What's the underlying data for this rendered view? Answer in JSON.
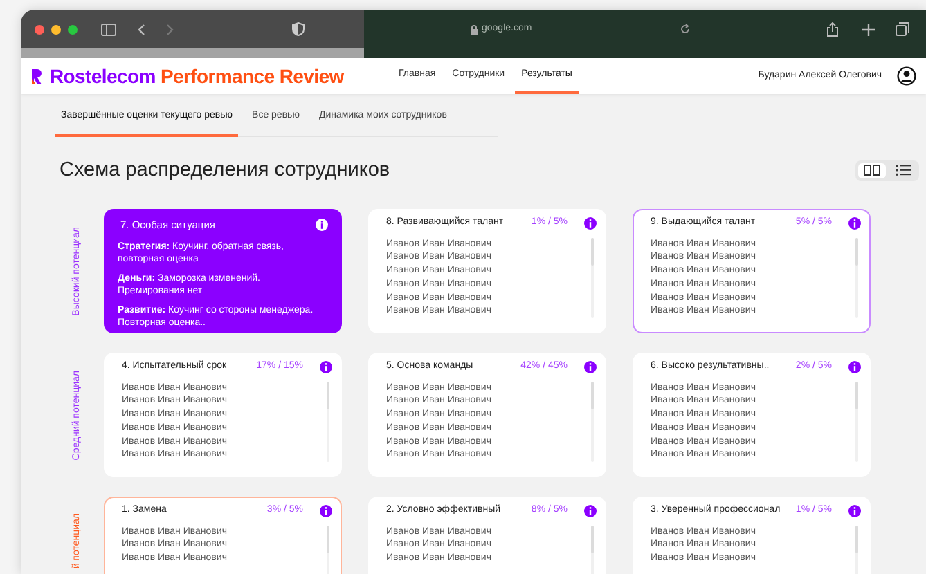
{
  "browser": {
    "url": "google.com"
  },
  "brand": {
    "primary": "Rostelecom",
    "secondary": "Performance Review"
  },
  "nav": [
    {
      "label": "Главная",
      "selected": false
    },
    {
      "label": "Сотрудники",
      "selected": false
    },
    {
      "label": "Результаты",
      "selected": true
    }
  ],
  "user": {
    "name": "Бударин Алексей Олегович"
  },
  "subtabs": [
    {
      "label": "Завершённые оценки текущего ревью",
      "selected": true
    },
    {
      "label": "Все ревью",
      "selected": false
    },
    {
      "label": "Динамика моих сотрудников",
      "selected": false
    }
  ],
  "title": "Схема распределения сотрудников",
  "view_toggle": [
    {
      "kind": "grid",
      "selected": true
    },
    {
      "kind": "list",
      "selected": false
    }
  ],
  "rows": [
    {
      "label": "Высокий потенциал",
      "color": "#9b30ff",
      "cards": [
        {
          "kind": "text",
          "title": "7. Особая ситуация",
          "paragraphs": [
            "**Стратегия:** Коучинг, обратная связь, повторная оценка",
            "**Деньги:** Заморозка изменений. Премирования нет",
            "**Развитие:** Коучинг со стороны менеджера. Повторная оценка.."
          ]
        },
        {
          "kind": "list",
          "title": "8. Развивающийся талант",
          "ratio": "1% / 5%",
          "names": [
            "Иванов Иван Иванович",
            "Иванов Иван Иванович",
            "Иванов Иван Иванович",
            "Иванов Иван Иванович",
            "Иванов Иван Иванович",
            "Иванов Иван Иванович"
          ]
        },
        {
          "kind": "list",
          "title": "9. Выдающийся талант",
          "ratio": "5% / 5%",
          "color": "#c98bff",
          "names": [
            "Иванов Иван Иванович",
            "Иванов Иван Иванович",
            "Иванов Иван Иванович",
            "Иванов Иван Иванович",
            "Иванов Иван Иванович",
            "Иванов Иван Иванович"
          ]
        }
      ]
    },
    {
      "label": "Средний потенциал",
      "color": "#9b30ff",
      "cards": [
        {
          "kind": "list",
          "title": "4. Испытательный срок",
          "ratio": "17% / 15%",
          "names": [
            "Иванов Иван Иванович",
            "Иванов Иван Иванович",
            "Иванов Иван Иванович",
            "Иванов Иван Иванович",
            "Иванов Иван Иванович",
            "Иванов Иван Иванович"
          ]
        },
        {
          "kind": "list",
          "title": "5. Основа команды",
          "ratio": "42% / 45%",
          "names": [
            "Иванов Иван Иванович",
            "Иванов Иван Иванович",
            "Иванов Иван Иванович",
            "Иванов Иван Иванович",
            "Иванов Иван Иванович",
            "Иванов Иван Иванович"
          ]
        },
        {
          "kind": "list",
          "title": "6. Высоко результативны..",
          "ratio": "2% / 5%",
          "names": [
            "Иванов Иван Иванович",
            "Иванов Иван Иванович",
            "Иванов Иван Иванович",
            "Иванов Иван Иванович",
            "Иванов Иван Иванович",
            "Иванов Иван Иванович"
          ]
        }
      ]
    },
    {
      "label": "й потенциал",
      "color": "#ff5a1f",
      "cards": [
        {
          "kind": "list",
          "title": "1. Замена",
          "ratio": "3% / 5%",
          "color": "#ffb59a",
          "names": [
            "Иванов Иван Иванович",
            "Иванов Иван Иванович",
            "Иванов Иван Иванович"
          ]
        },
        {
          "kind": "list",
          "title": "2. Условно эффективный",
          "ratio": "8% / 5%",
          "names": [
            "Иванов Иван Иванович",
            "Иванов Иван Иванович",
            "Иванов Иван Иванович"
          ]
        },
        {
          "kind": "list",
          "title": "3. Уверенный профессионал",
          "ratio": "1% / 5%",
          "names": [
            "Иванов Иван Иванович",
            "Иванов Иван Иванович",
            "Иванов Иван Иванович"
          ]
        }
      ]
    }
  ]
}
